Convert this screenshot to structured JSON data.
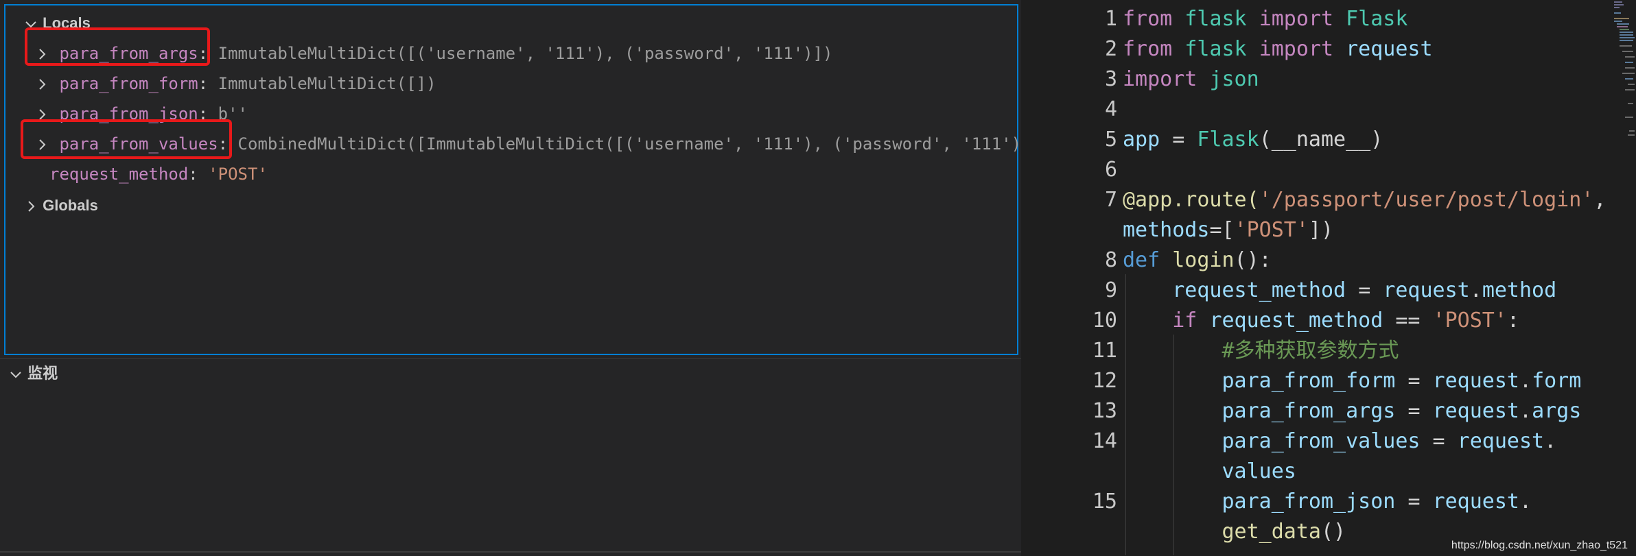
{
  "debug": {
    "locals_header": "Locals",
    "variables": [
      {
        "name": "para_from_args",
        "value": "ImmutableMultiDict([('username', '111'), ('password', '111')])"
      },
      {
        "name": "para_from_form",
        "value": "ImmutableMultiDict([])"
      },
      {
        "name": "para_from_json",
        "value": "b''"
      },
      {
        "name": "para_from_values",
        "value": "CombinedMultiDict([ImmutableMultiDict([('username', '111'), ('password', '111')…"
      },
      {
        "name": "request_method",
        "value": "'POST'"
      }
    ],
    "globals_header": "Globals",
    "watch_header": "监视"
  },
  "editor": {
    "line_numbers": [
      "1",
      "2",
      "3",
      "4",
      "5",
      "6",
      "7",
      "8",
      "9",
      "10",
      "11",
      "12",
      "13",
      "14",
      "15"
    ],
    "lines": {
      "l1": [
        "from",
        "flask",
        "import",
        "Flask"
      ],
      "l2": [
        "from",
        "flask",
        "import",
        "request"
      ],
      "l3": [
        "import",
        "json"
      ],
      "l5": [
        "app",
        "=",
        "Flask",
        "(__name__)"
      ],
      "l7a": [
        "@app.route(",
        "'/passport/user/post/login'",
        ","
      ],
      "l7b": [
        "methods",
        "=[",
        "'POST'",
        "])"
      ],
      "l8": [
        "def",
        "login",
        "():"
      ],
      "l9": [
        "request_method",
        "=",
        "request",
        ".",
        "method"
      ],
      "l10": [
        "if",
        "request_method",
        "==",
        "'POST'",
        ":"
      ],
      "l11": [
        "#多种获取参数方式"
      ],
      "l12": [
        "para_from_form",
        "=",
        "request",
        ".",
        "form"
      ],
      "l13": [
        "para_from_args",
        "=",
        "request",
        ".",
        "args"
      ],
      "l14a": [
        "para_from_values",
        "=",
        "request",
        "."
      ],
      "l14b": [
        "values"
      ],
      "l15a": [
        "para_from_json",
        "=",
        "request",
        "."
      ],
      "l15b": [
        "get_data",
        "()"
      ]
    }
  },
  "watermark": "https://blog.csdn.net/xun_zhao_t521",
  "colors": {
    "highlight_box": "#e8191a",
    "focus_border": "#007fd4",
    "keyword": "#c586c0",
    "variable": "#9cdcfe",
    "string": "#ce9178",
    "comment": "#6a9955",
    "class": "#4ec9b0"
  }
}
